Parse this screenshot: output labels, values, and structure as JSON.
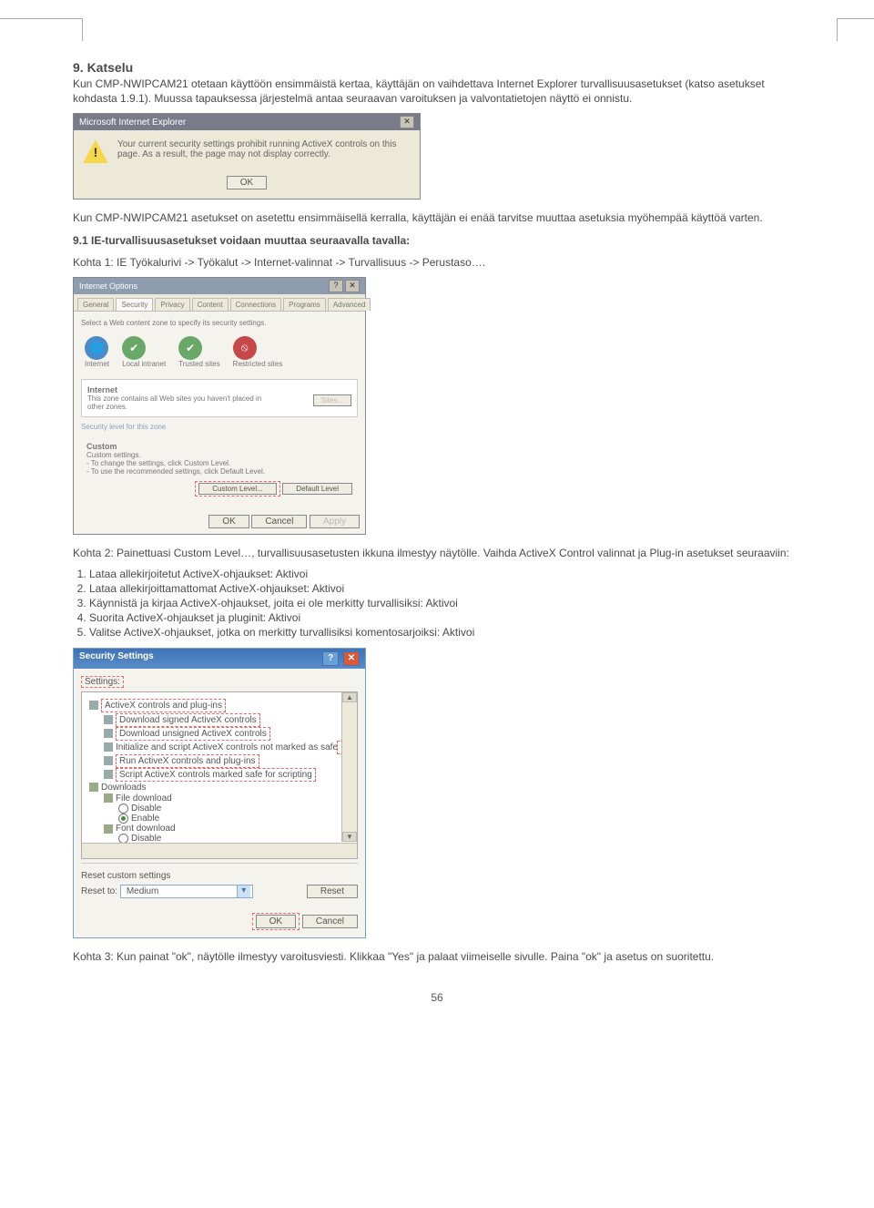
{
  "section": {
    "number_title": "9. Katselu",
    "p1": "Kun CMP-NWIPCAM21 otetaan käyttöön ensimmäistä kertaa, käyttäjän on vaihdettava Internet Explorer turvallisuusasetukset (katso asetukset kohdasta 1.9.1). Muussa tapauksessa järjestelmä antaa seuraavan varoituksen ja valvontatietojen näyttö ei onnistu."
  },
  "alert": {
    "title": "Microsoft Internet Explorer",
    "msg": "Your current security settings prohibit running ActiveX controls on this page. As a result, the page may not display correctly.",
    "ok": "OK"
  },
  "after_alert": "Kun CMP-NWIPCAM21 asetukset on asetettu ensimmäisellä kerralla, käyttäjän ei enää tarvitse muuttaa asetuksia myöhempää käyttöä varten.",
  "subsection": {
    "title": "9.1 IE-turvallisuusasetukset voidaan muuttaa seuraavalla tavalla:",
    "k1": "Kohta 1: IE Työkalurivi -> Työkalut -> Internet-valinnat -> Turvallisuus -> Perustaso…."
  },
  "ieopt": {
    "title": "Internet Options",
    "tabs": [
      "General",
      "Security",
      "Privacy",
      "Content",
      "Connections",
      "Programs",
      "Advanced"
    ],
    "zone_hint": "Select a Web content zone to specify its security settings.",
    "zones": {
      "internet": "Internet",
      "local": "Local intranet",
      "trusted": "Trusted sites",
      "restricted": "Restricted sites"
    },
    "internet_box_title": "Internet",
    "internet_box_desc": "This zone contains all Web sites you haven't placed in other zones.",
    "sites_btn": "Sites...",
    "sec_level": "Security level for this zone",
    "custom_head": "Custom",
    "custom_l1": "Custom settings.",
    "custom_l2": "- To change the settings, click Custom Level.",
    "custom_l3": "- To use the recommended settings, click Default Level.",
    "custom_btn": "Custom Level...",
    "default_btn": "Default Level",
    "ok": "OK",
    "cancel": "Cancel",
    "apply": "Apply"
  },
  "k2_intro": "Kohta 2: Painettuasi Custom Level…, turvallisuusasetusten ikkuna ilmestyy näytölle. Vaihda ActiveX Control valinnat ja Plug-in asetukset seuraaviin:",
  "k2_items": [
    "Lataa allekirjoitetut ActiveX-ohjaukset: Aktivoi",
    "Lataa allekirjoittamattomat ActiveX-ohjaukset: Aktivoi",
    "Käynnistä ja kirjaa ActiveX-ohjaukset, joita ei ole merkitty turvallisiksi: Aktivoi",
    "Suorita ActiveX-ohjaukset ja pluginit: Aktivoi",
    "Valitse ActiveX-ohjaukset, jotka on merkitty turvallisiksi komentosarjoiksi: Aktivoi"
  ],
  "secdlg": {
    "title": "Security Settings",
    "settings_label": "Settings:",
    "tree": {
      "ax": "ActiveX controls and plug-ins",
      "dl_signed": "Download signed ActiveX controls",
      "dl_unsigned": "Download unsigned ActiveX controls",
      "init_unsafe": "Initialize and script ActiveX controls not marked as safe",
      "run_plugins": "Run ActiveX controls and plug-ins",
      "script_safe": "Script ActiveX controls marked safe for scripting",
      "downloads": "Downloads",
      "file_dl": "File download",
      "disable": "Disable",
      "enable": "Enable",
      "font_dl": "Font download"
    },
    "reset_title": "Reset custom settings",
    "reset_to": "Reset to:",
    "reset_val": "Medium",
    "reset_btn": "Reset",
    "ok": "OK",
    "cancel": "Cancel"
  },
  "k3": "Kohta 3: Kun painat \"ok\", näytölle ilmestyy varoitusviesti. Klikkaa \"Yes\" ja palaat viimeiselle sivulle. Paina \"ok\" ja asetus on suoritettu.",
  "page_number": "56"
}
